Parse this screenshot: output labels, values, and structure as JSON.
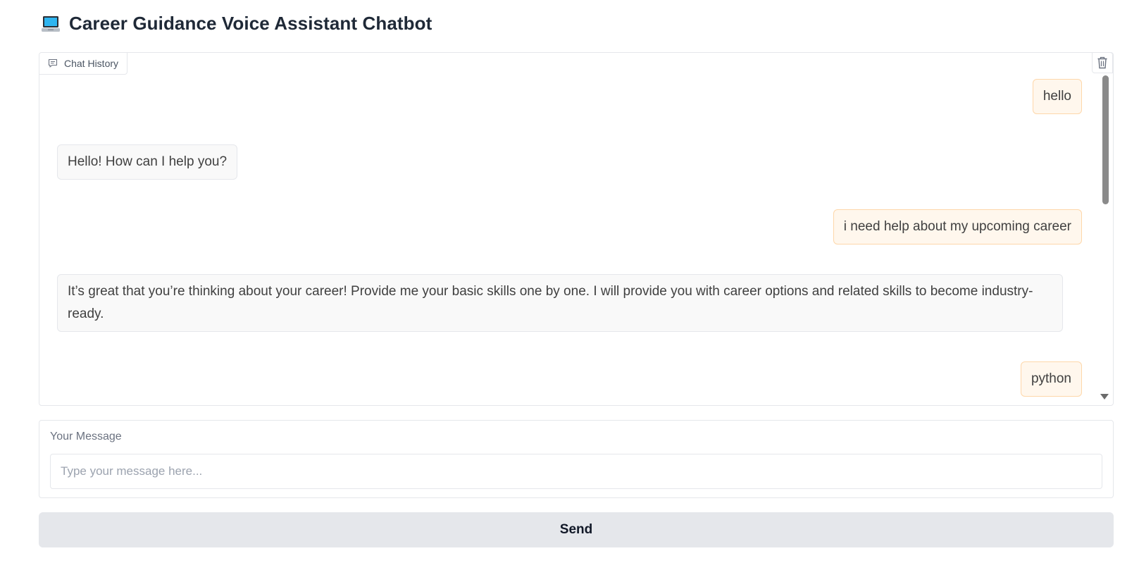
{
  "app": {
    "title_icon": "laptop-icon",
    "title": "Career Guidance Voice Assistant Chatbot"
  },
  "chat": {
    "label": "Chat History",
    "label_icon": "chat-bubble-icon",
    "clear_icon": "trash-icon",
    "messages": [
      {
        "role": "user",
        "text": "hello"
      },
      {
        "role": "bot",
        "text": "Hello! How can I help you?"
      },
      {
        "role": "user",
        "text": "i need help about my upcoming career"
      },
      {
        "role": "bot",
        "text": "It’s great that you’re thinking about your career! Provide me your basic skills one by one. I will provide you with career options and related skills to become industry-ready."
      },
      {
        "role": "user",
        "text": "python"
      }
    ]
  },
  "input": {
    "label": "Your Message",
    "placeholder": "Type your message here...",
    "value": ""
  },
  "send": {
    "label": "Send"
  },
  "colors": {
    "user_bubble": "#fff7ed",
    "user_bubble_border": "#fed7aa",
    "bot_bubble": "#f9f9f9",
    "button_bg": "#e5e7eb"
  }
}
